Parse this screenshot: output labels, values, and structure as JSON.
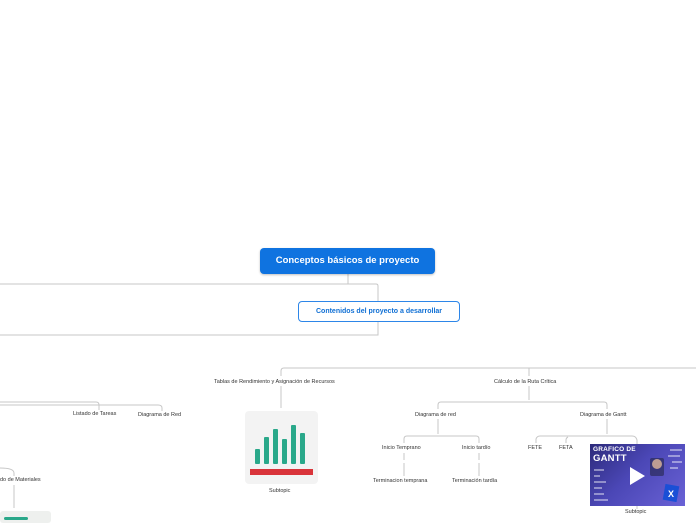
{
  "root": {
    "title": "Conceptos básicos de proyecto"
  },
  "main_topic": {
    "title": "Contenidos del proyecto a desarrollar"
  },
  "branches": {
    "tablas": "Tablas de Rendimiento y Asignación de Recursos",
    "ruta_critica": "Cálculo de la Ruta Crítica"
  },
  "left_side": {
    "listado_tareas": "Listado de Tareas",
    "diagrama_red": "Diagrama de Red",
    "listado_materiales": "do de Materiales"
  },
  "ruta_critica_children": {
    "diagrama_red": "Diagrama de red",
    "diagrama_gantt": "Diagrama de Gantt"
  },
  "diagrama_red_children": {
    "inicio_temprano": "Inicio Temprano",
    "inicio_tardio": "Inicio tardío",
    "terminacion_temprana": "Terminacion temprana",
    "terminacion_tardia": "Terminación tardía"
  },
  "gantt_children": {
    "fete": "FETE",
    "feta": "FETA"
  },
  "subtopics": {
    "chart": "Subtopic",
    "video": "Subtopic"
  },
  "video": {
    "title_line1": "GRAFICO DE",
    "title_line2": "GANTT"
  },
  "colors": {
    "root_fill": "#0f73e0",
    "topic_border": "#2d86e8",
    "connector": "#c7c7c7",
    "chart_bar": "#2aa88a",
    "chart_base": "#d9343a"
  },
  "icons": {
    "chart": "bar-chart-icon",
    "play": "play-icon",
    "excel": "excel-icon"
  }
}
